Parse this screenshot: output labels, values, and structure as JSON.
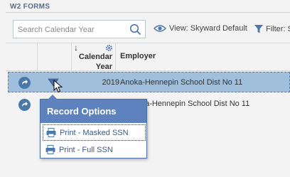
{
  "panel": {
    "title": "W2 FORMS"
  },
  "search": {
    "placeholder": "Search Calendar Year"
  },
  "view": {
    "label": "View: Skyward Default"
  },
  "filter": {
    "label": "Filter: S"
  },
  "table": {
    "headers": {
      "calendar_year_line1": "Calendar",
      "calendar_year_line2": "Year",
      "employer": "Employer"
    },
    "rows": [
      {
        "year": "2019",
        "employer": "Anoka-Hennepin School Dist No 11"
      },
      {
        "year": "",
        "employer": "Anoka-Hennepin School Dist No 11"
      }
    ]
  },
  "record_options": {
    "title": "Record Options",
    "items": [
      {
        "label": "Print - Masked SSN"
      },
      {
        "label": "Print - Full SSN"
      }
    ]
  },
  "colors": {
    "accent": "#5d82bd",
    "selected_row": "#9fbfdc",
    "title_text": "#5a6f8c"
  },
  "icons": [
    "search-icon",
    "eye-icon",
    "filter-icon",
    "gear-icon",
    "sort-down-arrow-icon",
    "row-action-icon",
    "dropdown-trigger-icon",
    "printer-icon",
    "mouse-cursor-icon"
  ]
}
